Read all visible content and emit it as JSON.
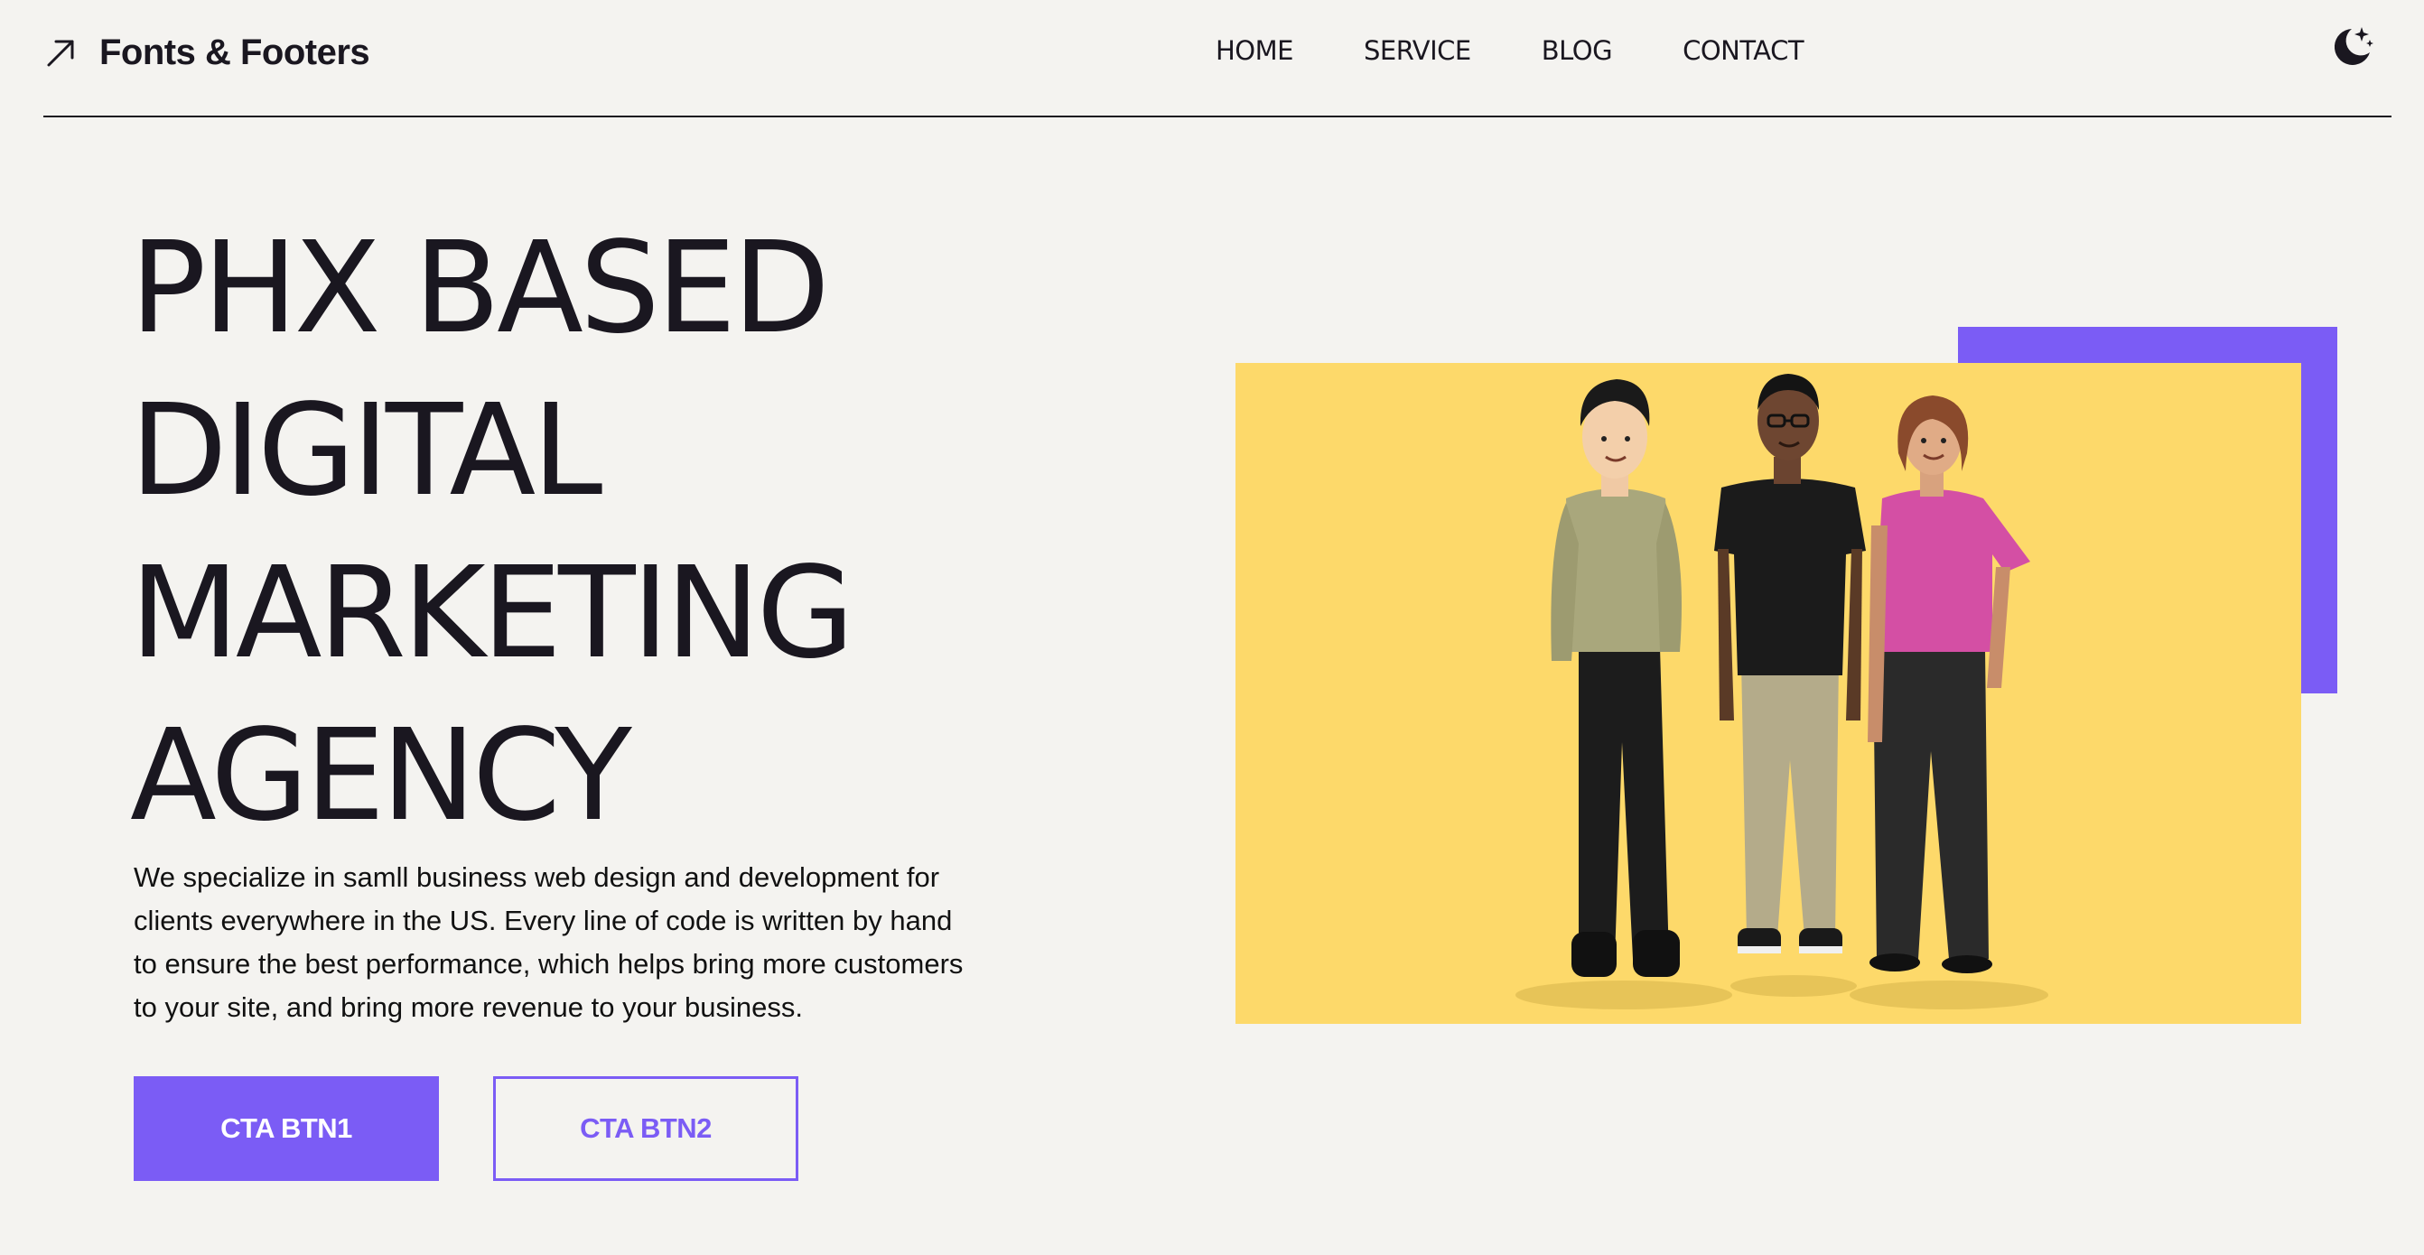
{
  "header": {
    "brand_name": "Fonts & Footers",
    "brand_icon": "arrow-up-right-icon",
    "nav": [
      {
        "label": "HOME"
      },
      {
        "label": "SERVICE"
      },
      {
        "label": "BLOG"
      },
      {
        "label": "CONTACT"
      }
    ],
    "theme_toggle_icon": "moon-stars-icon"
  },
  "hero": {
    "title_lines": [
      "PHX BASED",
      "DIGITAL",
      "MARKETING",
      "AGENCY"
    ],
    "description": "We specialize in samll business web design and development for clients everywhere in the US. Every line of code is written by hand to ensure the best performance, which helps bring more customers to your site, and bring more revenue to your business.",
    "cta_primary": "CTA BTN1",
    "cta_secondary": "CTA BTN2"
  },
  "illustration": {
    "description_icon": "three-people-illustration"
  },
  "colors": {
    "accent": "#7b5cf5",
    "illustration_bg": "#fdd96a",
    "page_bg": "#f4f3f0",
    "text": "#1a1720"
  }
}
